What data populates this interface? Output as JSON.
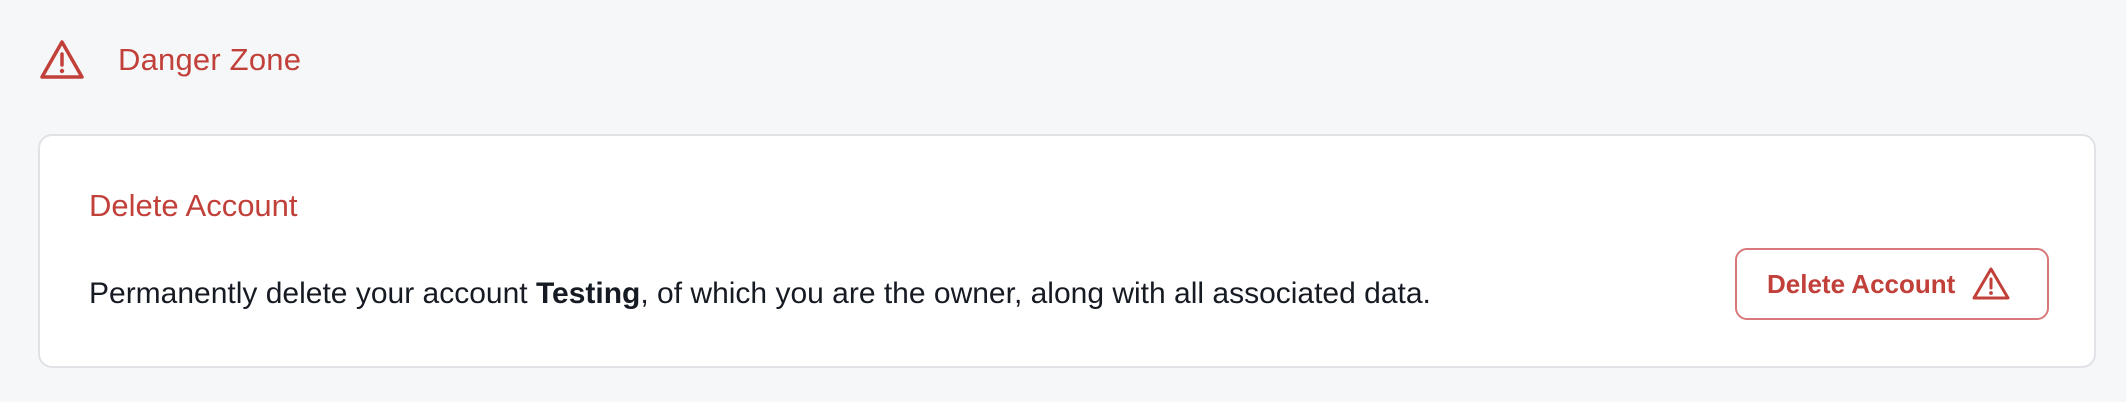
{
  "section": {
    "title": "Danger Zone",
    "icon": "warning-triangle-icon",
    "color": "#c2403a"
  },
  "card": {
    "title": "Delete Account",
    "description": {
      "prefix": "Permanently delete your account ",
      "account_name": "Testing",
      "suffix": ", of which you are the owner, along with all associated data."
    },
    "button": {
      "label": "Delete Account",
      "icon": "warning-triangle-icon",
      "border_color": "#d9787a"
    }
  }
}
